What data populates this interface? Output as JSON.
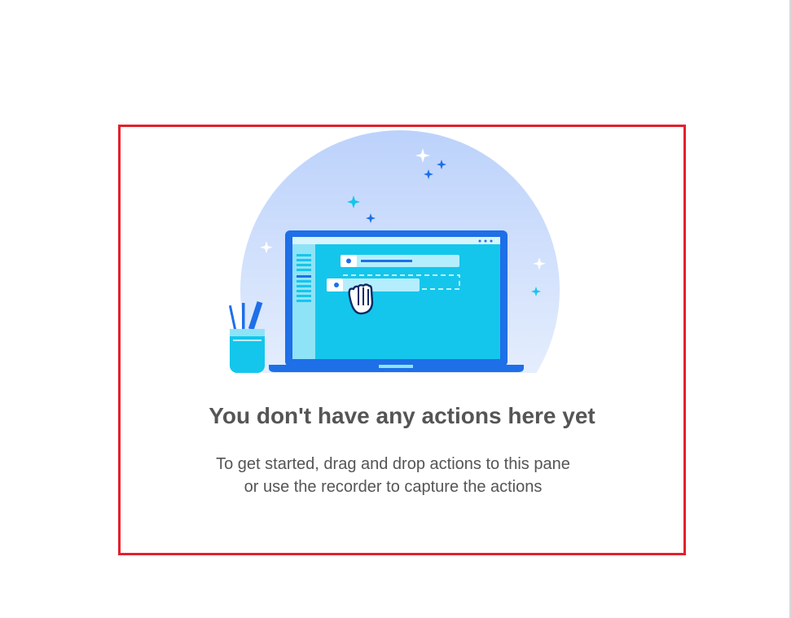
{
  "empty_state": {
    "title": "You don't have any actions here yet",
    "description_line1": "To get started, drag and drop actions to this pane",
    "description_line2": "or use the recorder to capture the actions",
    "illustration_icon": "laptop-drag-drop-illustration"
  },
  "colors": {
    "highlight_border": "#e3202c",
    "text": "#555555",
    "laptop_blue": "#1e6fe8",
    "screen_cyan": "#0fc4f0"
  }
}
